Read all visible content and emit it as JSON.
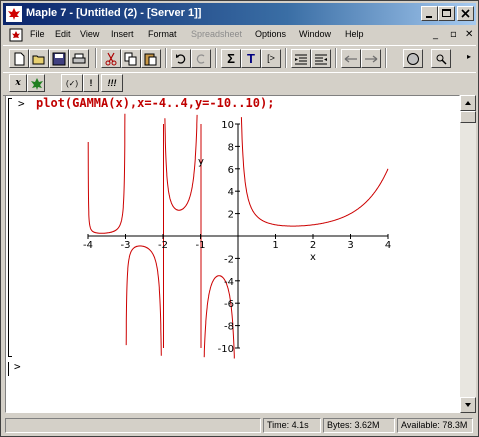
{
  "window": {
    "title": "Maple 7 - [Untitled (2) - [Server 1]]"
  },
  "menu": {
    "items": [
      {
        "label": "File",
        "enabled": true
      },
      {
        "label": "Edit",
        "enabled": true
      },
      {
        "label": "View",
        "enabled": true
      },
      {
        "label": "Insert",
        "enabled": true
      },
      {
        "label": "Format",
        "enabled": true
      },
      {
        "label": "Spreadsheet",
        "enabled": false
      },
      {
        "label": "Options",
        "enabled": true
      },
      {
        "label": "Window",
        "enabled": true
      },
      {
        "label": "Help",
        "enabled": true
      }
    ]
  },
  "toolbar": {
    "sigma_label": "Σ",
    "text_label": "T",
    "prompt_label": "[>",
    "math_x_label": "x",
    "paren_label": "(✓)",
    "exclaim_label": "!",
    "triple_exclaim_label": "!!!"
  },
  "worksheet": {
    "prompt": ">",
    "command": "plot(GAMMA(x),x=-4..4,y=-10..10);",
    "empty_prompt": ">"
  },
  "chart_data": {
    "type": "line",
    "series": [
      {
        "color": "#cc0000",
        "function": "GAMMA(x)"
      }
    ],
    "xlim": [
      -4,
      4
    ],
    "ylim": [
      -10,
      10
    ],
    "xlabel": "x",
    "ylabel": "y",
    "xticks": [
      -4,
      -3,
      -2,
      -1,
      1,
      2,
      3,
      4
    ],
    "yticks": [
      -10,
      -8,
      -6,
      -4,
      -2,
      2,
      4,
      6,
      8,
      10
    ],
    "grid": false
  },
  "status": {
    "time": "Time: 4.1s",
    "bytes": "Bytes: 3.62M",
    "available": "Available: 78.3M"
  },
  "colors": {
    "titlebar_start": "#0a246a",
    "command_red": "#c00000",
    "curve_red": "#cc0000"
  }
}
